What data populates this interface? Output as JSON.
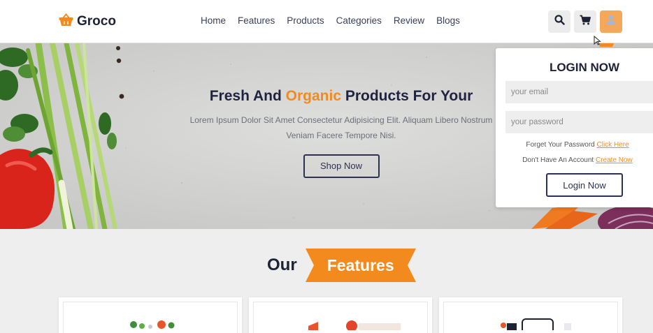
{
  "brand": {
    "name": "Groco",
    "icon": "basket-icon"
  },
  "nav": {
    "items": [
      {
        "label": "Home"
      },
      {
        "label": "Features"
      },
      {
        "label": "Products"
      },
      {
        "label": "Categories"
      },
      {
        "label": "Review"
      },
      {
        "label": "Blogs"
      }
    ]
  },
  "header_icons": [
    "search-icon",
    "cart-icon",
    "user-icon"
  ],
  "hero": {
    "title_part1": "Fresh And ",
    "title_accent": "Organic",
    "title_part2": " Products For Your",
    "text": "Lorem Ipsum Dolor Sit Amet Consectetur Adipisicing Elit. Aliquam Libero Nostrum Veniam Facere Tempore Nisi.",
    "button": "Shop Now"
  },
  "login": {
    "title": "LOGIN NOW",
    "email_placeholder": "your email",
    "password_placeholder": "your password",
    "forgot_text": "Forget Your Password",
    "forgot_link": "Click Here",
    "account_text": "Don't Have An Account",
    "account_link": "Create Now",
    "button": "Login Now"
  },
  "features": {
    "heading_prefix": "Our",
    "heading_highlight": "Features"
  },
  "colors": {
    "accent": "#f28a1d",
    "dark": "#1e2235",
    "user_button": "#f6a85a"
  }
}
